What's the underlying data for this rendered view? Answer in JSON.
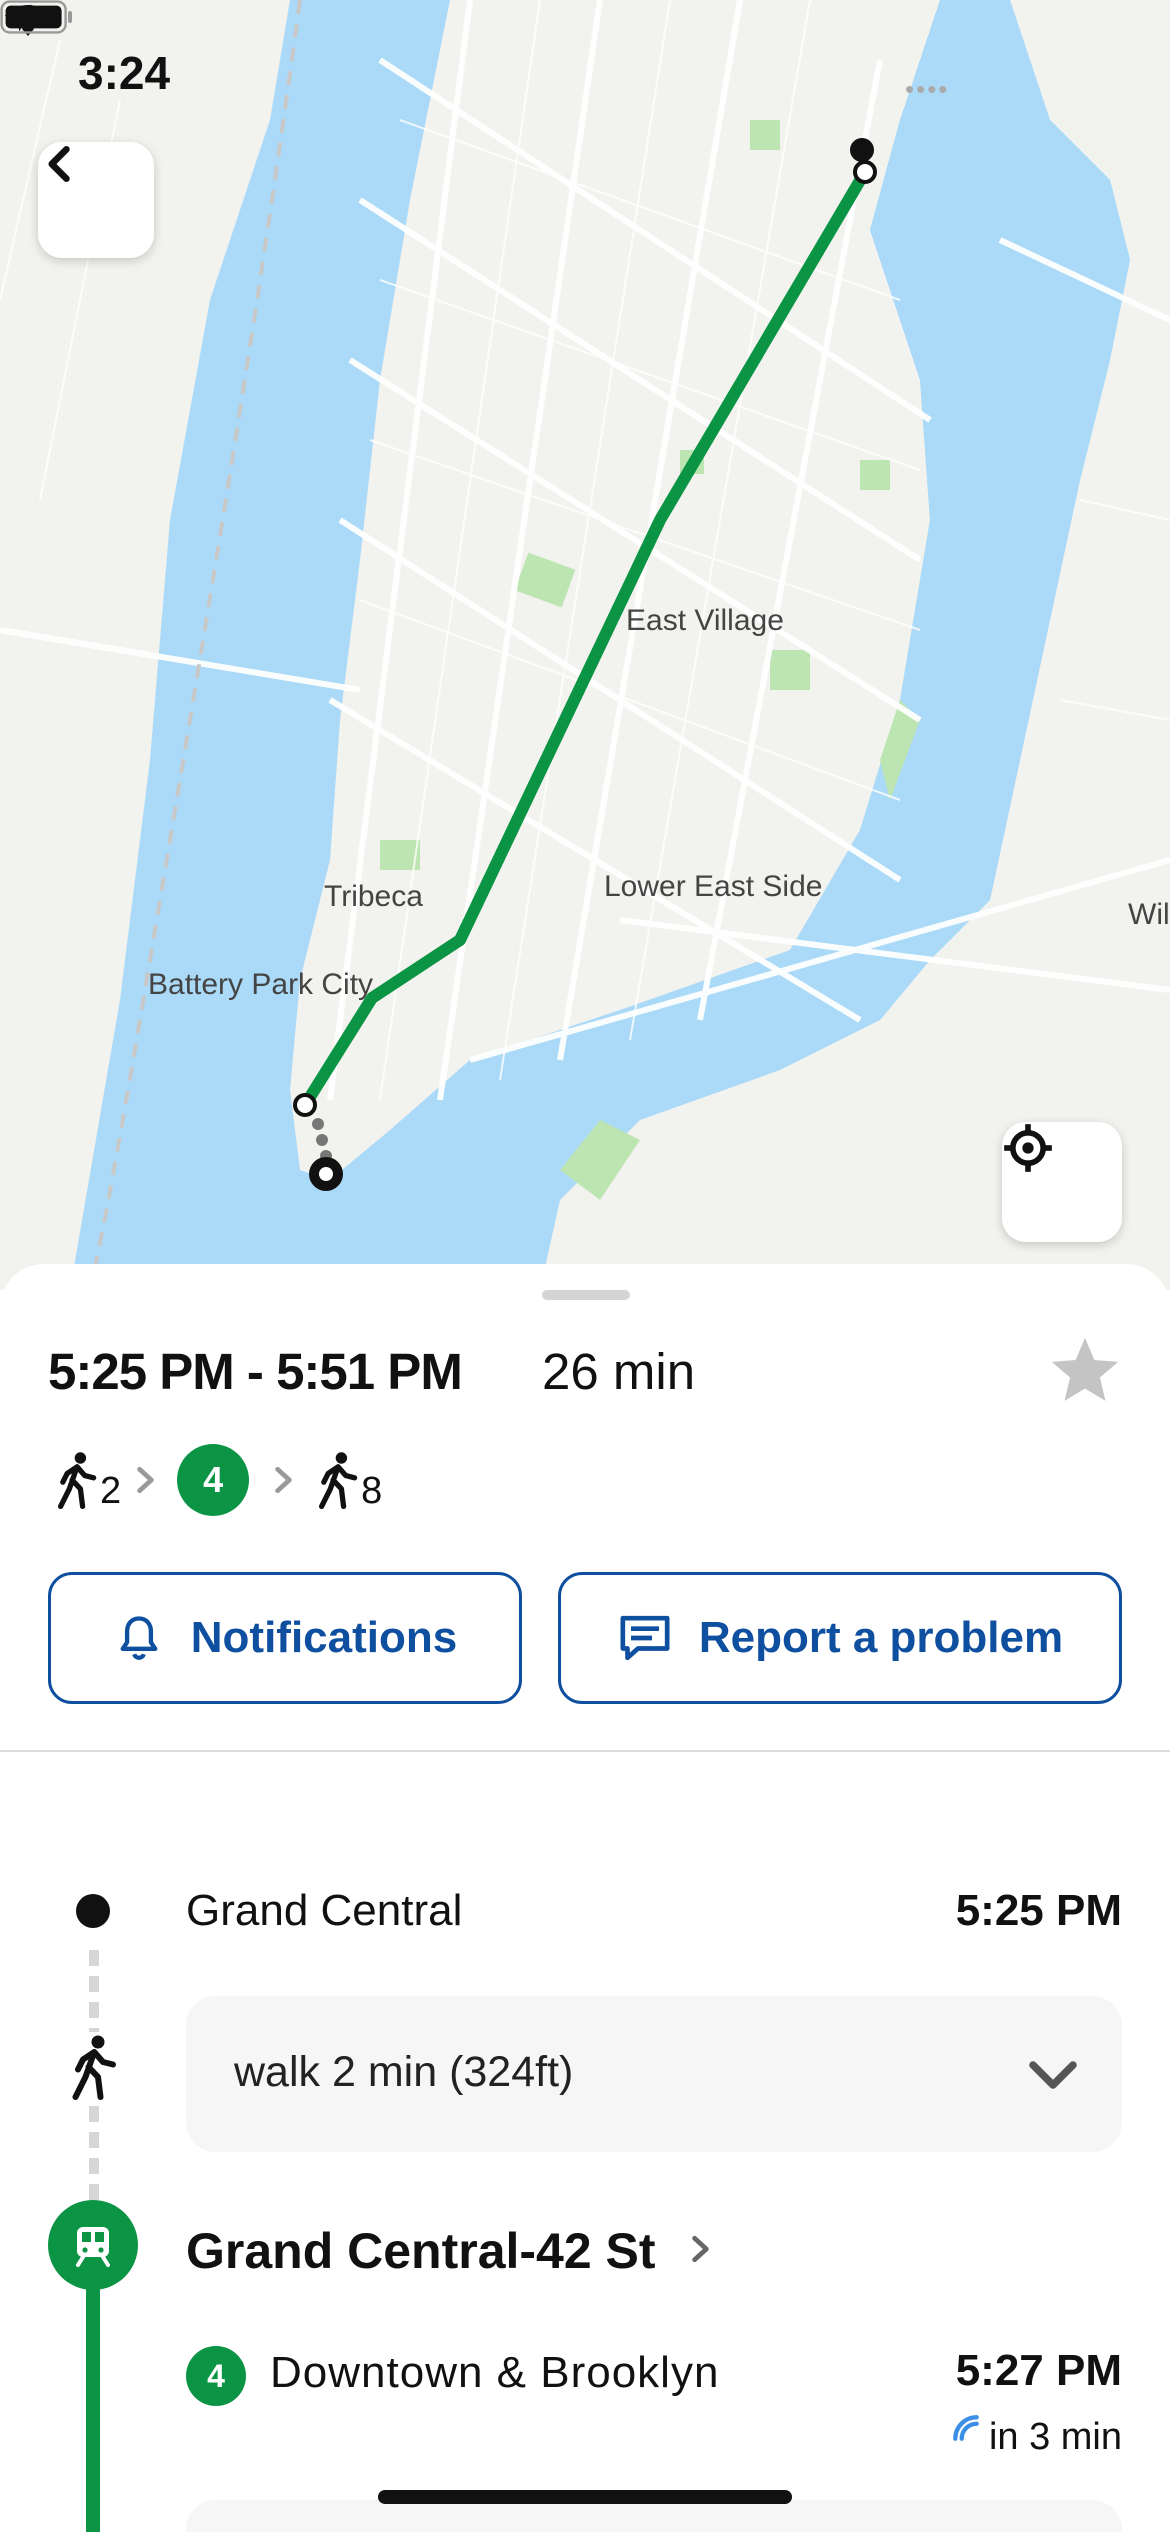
{
  "status_bar": {
    "time": "3:24",
    "signal": "••••"
  },
  "map": {
    "labels": {
      "east_village": "East Village",
      "lower_east_side": "Lower East Side",
      "tribeca": "Tribeca",
      "battery_park_city": "Battery Park City",
      "williamsburg_partial": "Wil"
    },
    "route_color": "#0b9444"
  },
  "trip": {
    "time_range": "5:25 PM - 5:51 PM",
    "duration": "26 min",
    "legs": {
      "walk_start_min": "2",
      "route": "4",
      "walk_end_min": "8"
    }
  },
  "actions": {
    "notifications_label": "Notifications",
    "report_label": "Report a problem"
  },
  "itinerary": {
    "origin": {
      "name": "Grand Central",
      "time": "5:25 PM"
    },
    "walk": {
      "text": "walk 2 min (324ft)"
    },
    "station": {
      "name": "Grand Central-42 St"
    },
    "departure": {
      "route": "4",
      "direction": "Downtown & Brooklyn",
      "time": "5:27 PM",
      "realtime": "in 3 min"
    }
  },
  "colors": {
    "accent_blue": "#0f4fa0",
    "subway_green": "#0b9444",
    "water": "#aadaf7",
    "land": "#f2f2ef",
    "park": "#bde5b2"
  }
}
